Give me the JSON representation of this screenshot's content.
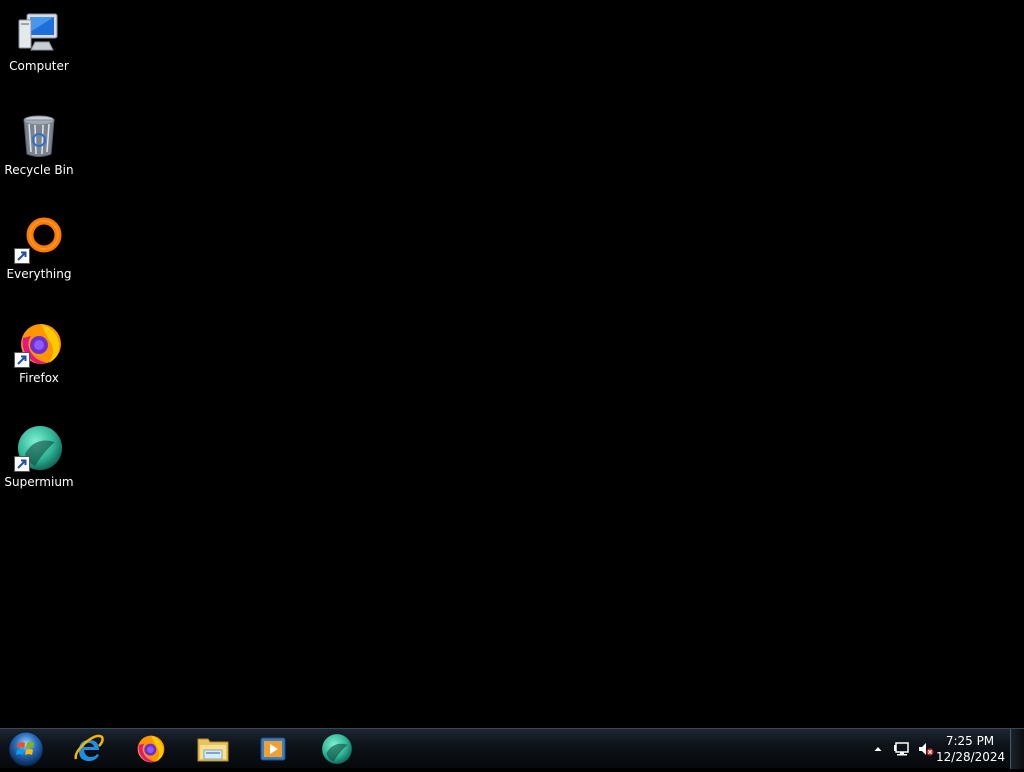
{
  "desktop": {
    "icons": [
      {
        "label": "Computer",
        "icon": "computer-icon",
        "shortcut": false
      },
      {
        "label": "Recycle Bin",
        "icon": "recycle-bin-icon",
        "shortcut": false
      },
      {
        "label": "Everything",
        "icon": "everything-icon",
        "shortcut": true
      },
      {
        "label": "Firefox",
        "icon": "firefox-icon",
        "shortcut": true
      },
      {
        "label": "Supermium",
        "icon": "supermium-icon",
        "shortcut": true
      }
    ]
  },
  "taskbar": {
    "start_button": "start-orb-icon",
    "pinned": [
      {
        "name": "internet-explorer-icon"
      },
      {
        "name": "firefox-icon"
      },
      {
        "name": "file-explorer-icon"
      },
      {
        "name": "media-player-icon"
      },
      {
        "name": "supermium-icon"
      }
    ],
    "tray": {
      "icons": [
        "show-hidden-icons-arrow",
        "network-icon",
        "volume-muted-icon"
      ],
      "time": "7:25 PM",
      "date": "12/28/2024"
    }
  },
  "colors": {
    "desktop_background": "#000000",
    "taskbar": "#0d1218",
    "text": "#ffffff"
  }
}
